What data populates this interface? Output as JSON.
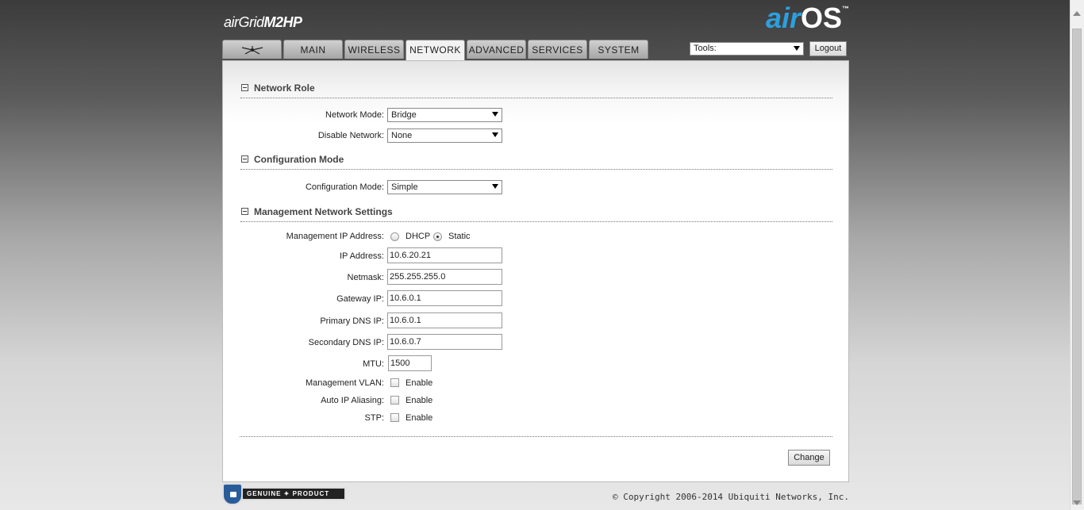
{
  "header": {
    "device_logo_prefix": "air",
    "device_logo_main": "Grid",
    "device_logo_model": "M2HP",
    "airos_air": "air",
    "airos_os": "OS",
    "airos_tm": "™"
  },
  "tabs": [
    {
      "label": "",
      "icon": "ubiquiti-logo-icon"
    },
    {
      "label": "MAIN"
    },
    {
      "label": "WIRELESS"
    },
    {
      "label": "NETWORK",
      "active": true
    },
    {
      "label": "ADVANCED"
    },
    {
      "label": "SERVICES"
    },
    {
      "label": "SYSTEM"
    }
  ],
  "toolbar": {
    "tools_value": "Tools:",
    "logout_label": "Logout"
  },
  "network_role": {
    "title": "Network Role",
    "network_mode_label": "Network Mode:",
    "network_mode_value": "Bridge",
    "disable_network_label": "Disable Network:",
    "disable_network_value": "None"
  },
  "configuration_mode": {
    "title": "Configuration Mode",
    "config_mode_label": "Configuration Mode:",
    "config_mode_value": "Simple"
  },
  "management": {
    "title": "Management Network Settings",
    "mgmt_ip_label": "Management IP Address:",
    "dhcp_label": "DHCP",
    "static_label": "Static",
    "selected": "Static",
    "ip_label": "IP Address:",
    "ip_value": "10.6.20.21",
    "netmask_label": "Netmask:",
    "netmask_value": "255.255.255.0",
    "gateway_label": "Gateway IP:",
    "gateway_value": "10.6.0.1",
    "pdns_label": "Primary DNS IP:",
    "pdns_value": "10.6.0.1",
    "sdns_label": "Secondary DNS IP:",
    "sdns_value": "10.6.0.7",
    "mtu_label": "MTU:",
    "mtu_value": "1500",
    "vlan_label": "Management VLAN:",
    "alias_label": "Auto IP Aliasing:",
    "stp_label": "STP:",
    "enable_label": "Enable"
  },
  "actions": {
    "change_label": "Change"
  },
  "footer": {
    "badge_text": "GENUINE ✦ PRODUCT",
    "copyright": "© Copyright 2006-2014 Ubiquiti Networks, Inc."
  }
}
